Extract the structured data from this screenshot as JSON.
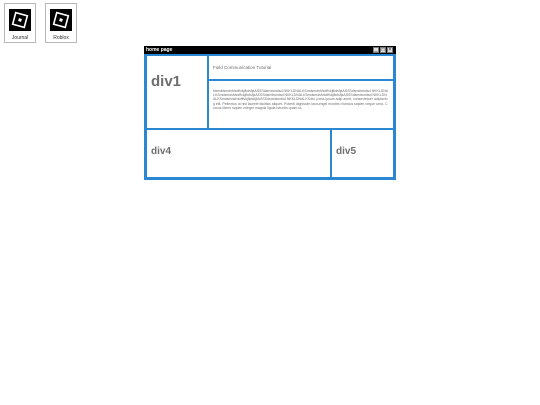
{
  "desktop": {
    "icons": [
      {
        "label": "Journal"
      },
      {
        "label": "Roblox"
      }
    ]
  },
  "window": {
    "title": "home page",
    "controls": {
      "minimize": "_",
      "maximize": "□",
      "close": "×"
    }
  },
  "panels": {
    "div1": {
      "label": "div1"
    },
    "header": {
      "text": "Field Communication Tutorial"
    },
    "content": {
      "text": "fdsmfdsmdsfvkdffvkjfkdsfjkASSSdsmdsmdsd NKKLDNALKSmdsmdsfvkdffvkjfkdsfjkASSSdsmdsmdsd NKKLDNALKSmdsmdsfvkdffvkjfkdsfjkASSSdsmdsmdsd NKKLDNALKSmdsmdsfvkdffvkjfkdsfjkASSSdsmdsmdsd NKKLDNALKSmdsmdsfvkdffvkjfkdsfjkASSSdsmdsmdsd NKKLDNALKSdsl, porta ipsum adip amet, consectetuer adipiscing elit. Pellentus ut nisl laoreet facilisis aliquet. Potenti dignissim laccumgel montes rhoncus sapien neque urna. Cursus libero sapien integer magnis ligula lobortis quam ut."
    },
    "div4": {
      "label": "div4"
    },
    "div5": {
      "label": "div5"
    }
  }
}
